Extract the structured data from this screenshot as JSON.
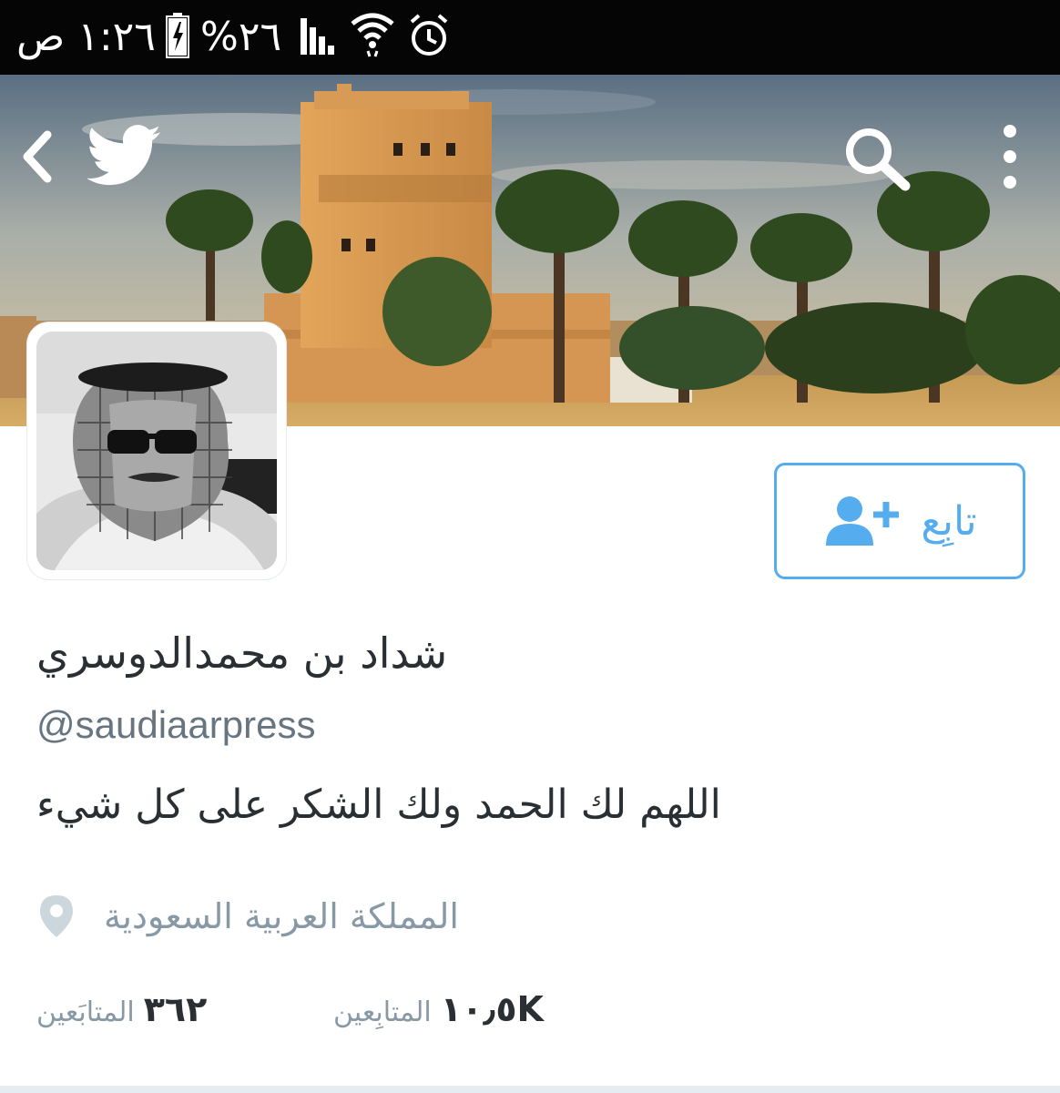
{
  "status_bar": {
    "time": "١:٢٦ ص",
    "battery_percent": "%٢٦",
    "icons": [
      "battery-charging-icon",
      "signal-icon",
      "wifi-icon",
      "alarm-icon"
    ]
  },
  "header": {
    "icons": [
      "back-arrow-icon",
      "twitter-bird-icon",
      "search-icon",
      "more-vertical-icon"
    ]
  },
  "profile": {
    "follow_label": "تابِع",
    "display_name": "شداد بن محمدالدوسري",
    "handle": "@saudiaarpress",
    "bio": "اللهم لك الحمد ولك الشكر على كل شيء",
    "location": "المملكة العربية السعودية",
    "stats": {
      "following_count": "٣٦٢",
      "following_label": "المتابَعين",
      "followers_count": "١٠٫٥K",
      "followers_label": "المتابِعين"
    }
  },
  "colors": {
    "accent": "#55acee",
    "text_primary": "#292f33",
    "text_secondary": "#66757f",
    "text_muted": "#8899a6",
    "status_bar_bg": "#050505"
  }
}
